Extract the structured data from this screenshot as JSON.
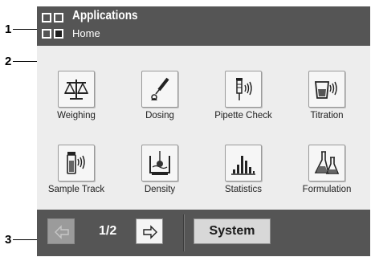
{
  "callouts": [
    "1",
    "2",
    "3"
  ],
  "header": {
    "title": "Applications",
    "subtitle": "Home"
  },
  "apps": [
    {
      "label": "Weighing",
      "icon": "balance-scale-icon"
    },
    {
      "label": "Dosing",
      "icon": "dosing-pipette-icon"
    },
    {
      "label": "Pipette Check",
      "icon": "pipette-check-icon"
    },
    {
      "label": "Titration",
      "icon": "titration-beaker-icon"
    },
    {
      "label": "Sample Track",
      "icon": "sample-vial-icon"
    },
    {
      "label": "Density",
      "icon": "density-sinker-icon"
    },
    {
      "label": "Statistics",
      "icon": "statistics-bars-icon"
    },
    {
      "label": "Formulation",
      "icon": "formulation-flasks-icon"
    }
  ],
  "footer": {
    "page_indicator": "1/2",
    "system_label": "System"
  },
  "colors": {
    "bar": "#555555",
    "screen_bg": "#ededed",
    "button_bg": "#f6f6f6"
  }
}
